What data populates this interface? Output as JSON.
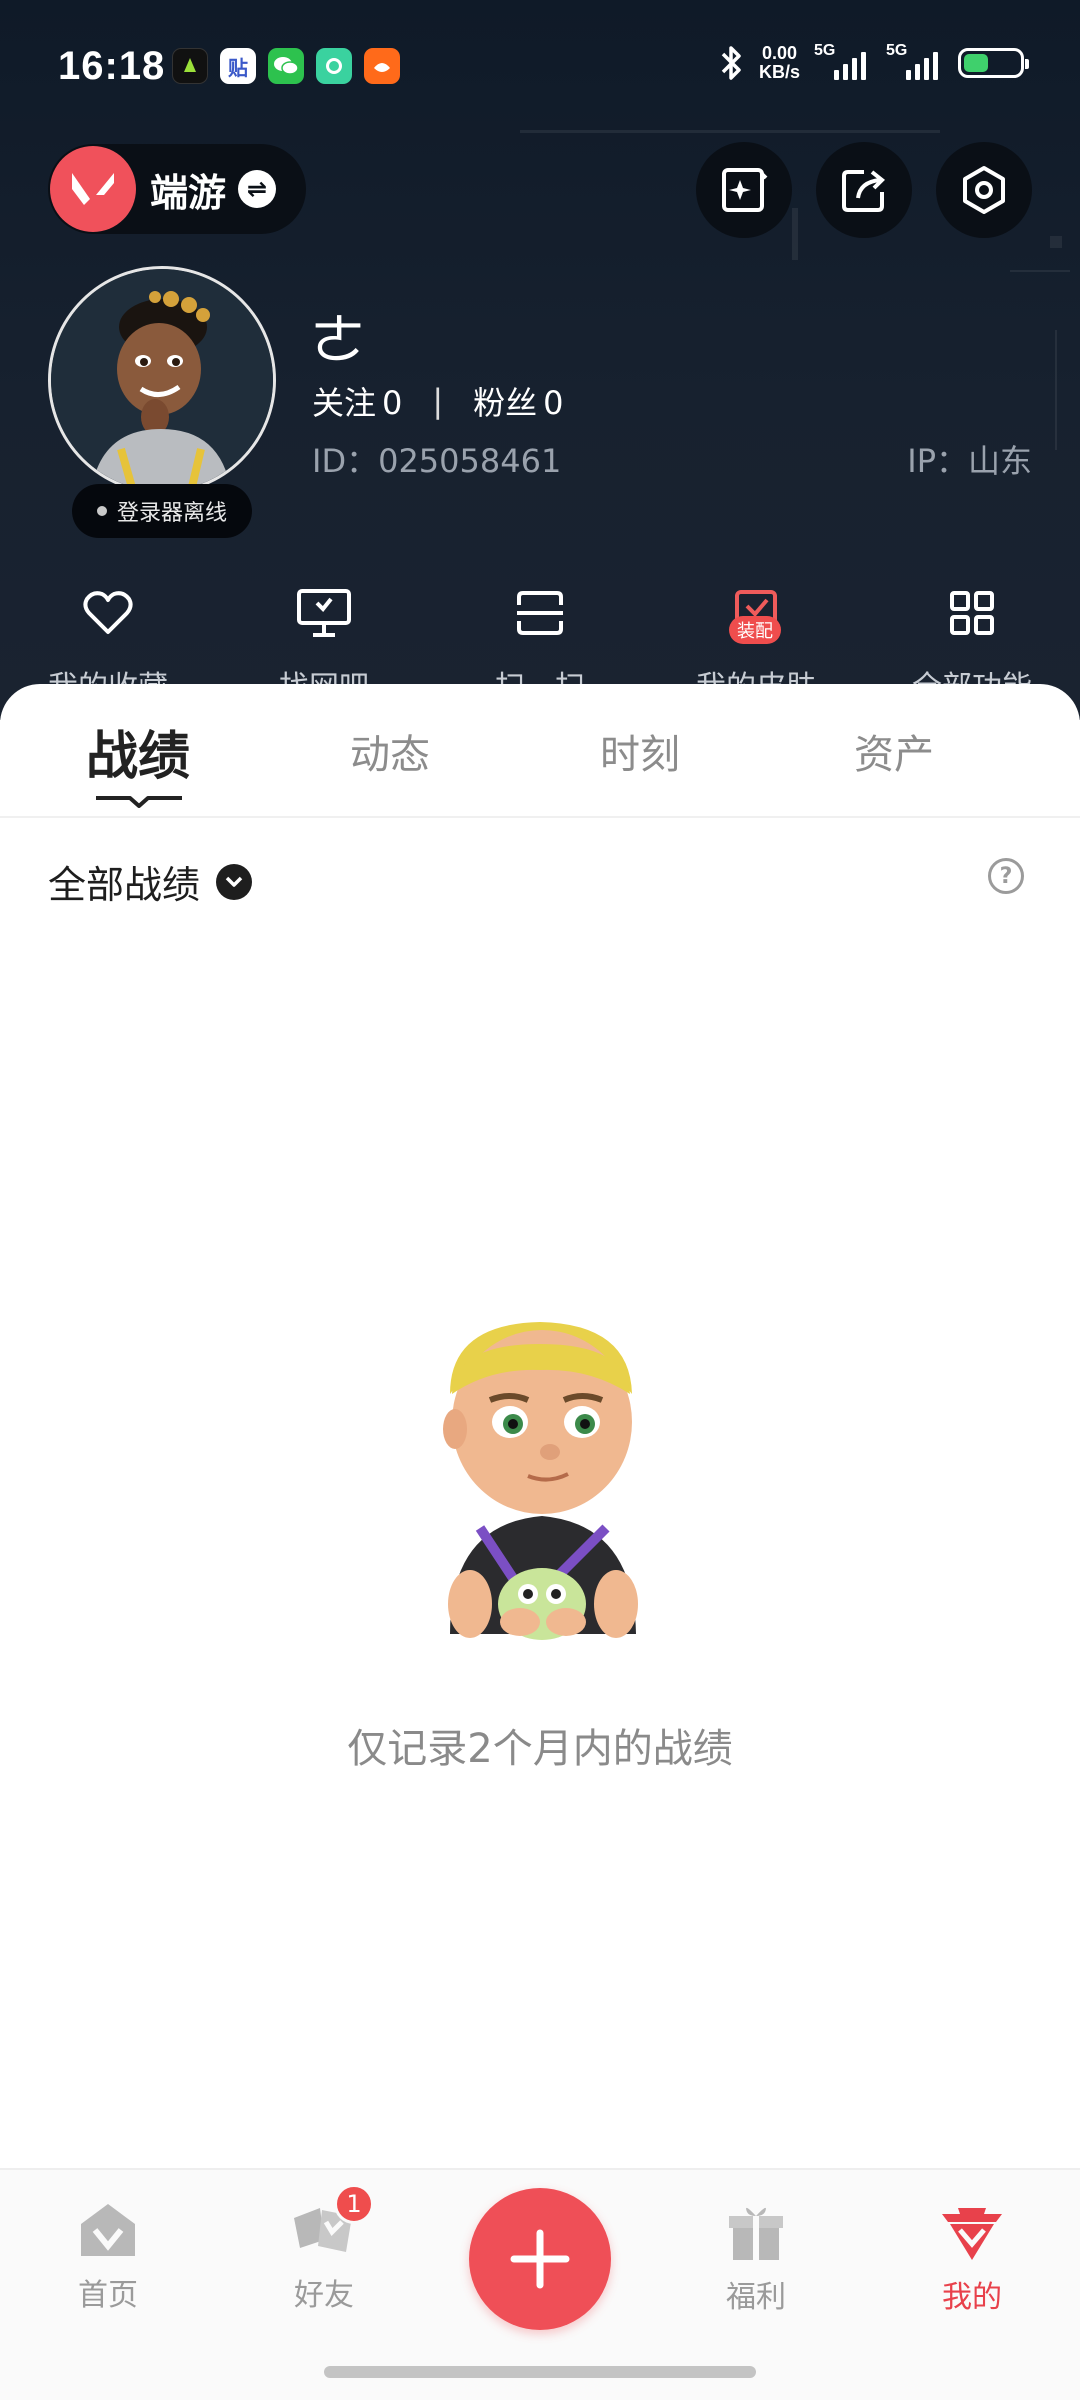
{
  "status_bar": {
    "time": "16:18",
    "net_speed_value": "0.00",
    "net_speed_unit": "KB/s",
    "sim1_label": "5G",
    "sim2_label": "5G",
    "battery_level": 0.45,
    "notification_icons": [
      "game-app-icon",
      "tieba-icon",
      "wechat-icon",
      "camera-app-icon",
      "taobao-icon"
    ]
  },
  "header": {
    "app_name": "端游",
    "app_swap_glyph": "⇌"
  },
  "profile": {
    "nickname": "ㄜ",
    "follow_label": "关注",
    "follow_count": "0",
    "fans_label": "粉丝",
    "fans_count": "0",
    "separator": "|",
    "id_text": "ID：025058461",
    "ip_text": "IP：山东",
    "status_text": "登录器离线"
  },
  "quick_actions": [
    {
      "label": "我的收藏",
      "icon": "heart-icon"
    },
    {
      "label": "找网吧",
      "icon": "monitor-icon"
    },
    {
      "label": "扫一扫",
      "icon": "scan-icon"
    },
    {
      "label": "我的皮肤",
      "icon": "skin-icon",
      "badge": "装配"
    },
    {
      "label": "全部功能",
      "icon": "grid-icon"
    }
  ],
  "tabs": [
    "战绩",
    "动态",
    "时刻",
    "资产"
  ],
  "filter": {
    "label": "全部战绩",
    "help_glyph": "?"
  },
  "empty_state": {
    "text": "仅记录2个月内的战绩"
  },
  "bottom_nav": {
    "items": [
      {
        "label": "首页",
        "icon": "home-icon"
      },
      {
        "label": "好友",
        "icon": "friends-icon",
        "badge": "1"
      },
      {
        "label": "福利",
        "icon": "gift-icon"
      },
      {
        "label": "我的",
        "icon": "profile-icon"
      }
    ],
    "active": "我的"
  },
  "colors": {
    "accent": "#ef4f57",
    "header_bg": "#17212f",
    "badge": "#ef4d4d"
  }
}
